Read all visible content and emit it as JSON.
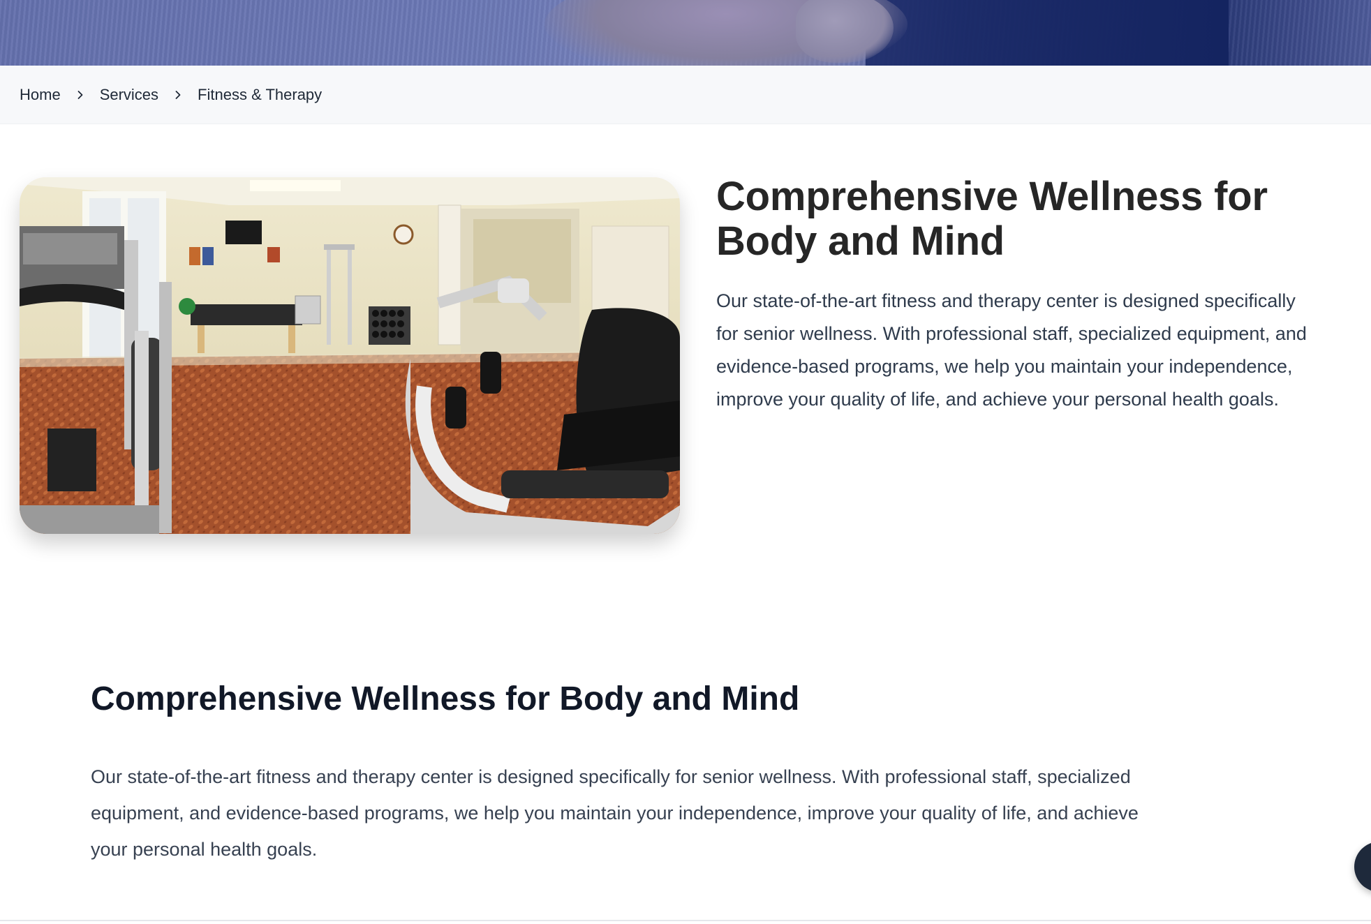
{
  "breadcrumb": {
    "items": [
      {
        "label": "Home"
      },
      {
        "label": "Services"
      },
      {
        "label": "Fitness & Therapy"
      }
    ],
    "separator_icon": "chevron-right-icon"
  },
  "intro": {
    "title_line1": "Comprehensive Wellness for",
    "title_line2": "Body and Mind",
    "text_lines": [
      "Our state-of-the-art fitness and therapy center is designed specifically",
      "for senior wellness. With professional staff, specialized equipment, and",
      "evidence-based programs, we help you maintain your independence,",
      "improve your quality of life, and achieve your personal health goals."
    ]
  },
  "section": {
    "title": "Comprehensive Wellness for Body and Mind",
    "text_lines": [
      "Our state-of-the-art fitness and therapy center is designed specifically for senior wellness. With professional staff, specialized",
      "equipment, and evidence-based programs, we help you maintain your independence, improve your quality of life, and achieve",
      "your personal health goals."
    ]
  },
  "colors": {
    "hero_blue": "#6c79b6",
    "hero_navy": "#1d2d6b",
    "breadcrumb_bg": "#f7f8fa",
    "heading": "#262626",
    "body_text": "#2f3b4c",
    "floating_button": "#1e293b"
  }
}
